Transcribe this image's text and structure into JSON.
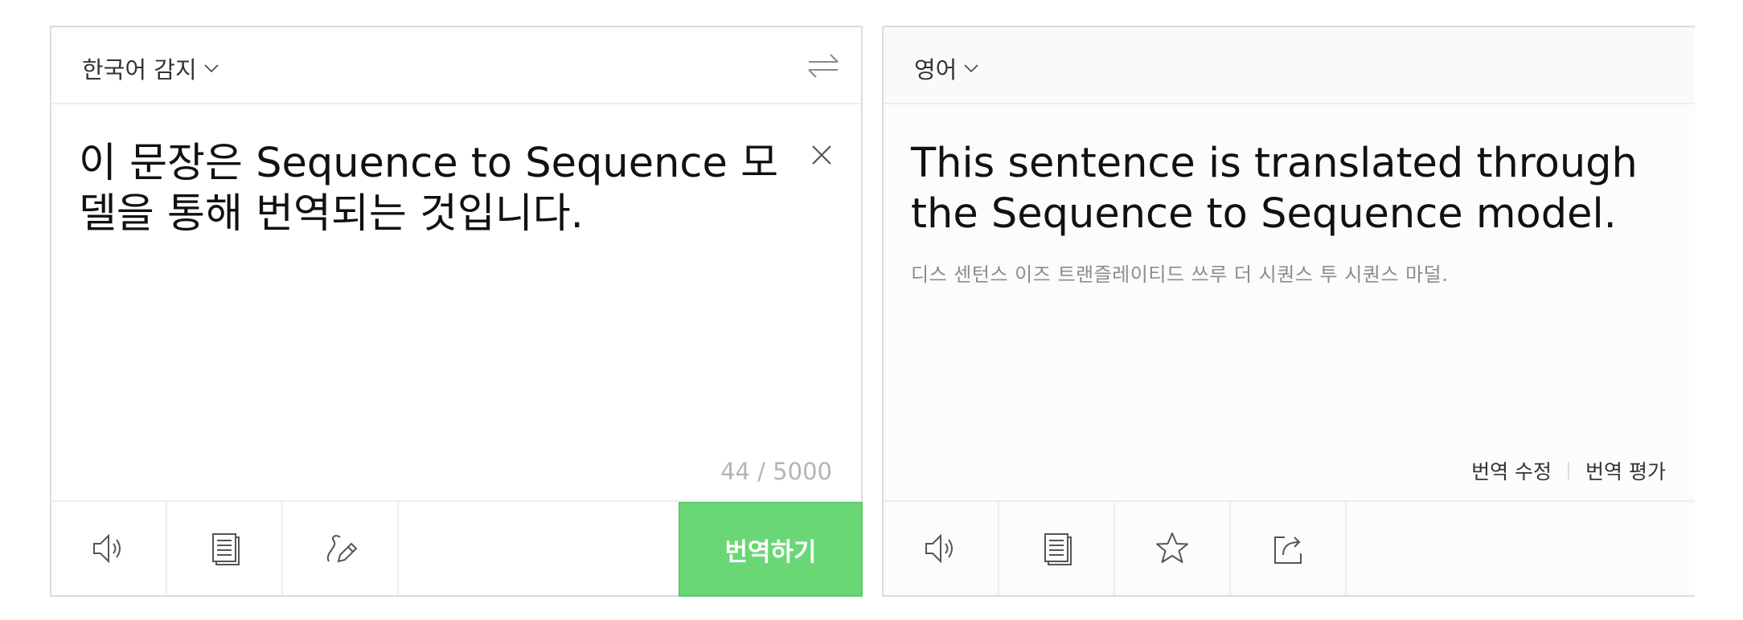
{
  "source": {
    "language_label": "한국어 감지",
    "text": "이 문장은 Sequence to Sequence 모델을 통해 번역되는 것입니다.",
    "char_count": "44 / 5000",
    "translate_button": "번역하기",
    "toolbar_icons": [
      "speaker-icon",
      "copy-icon",
      "handwriting-icon"
    ]
  },
  "target": {
    "language_label": "영어",
    "text": "This sentence is translated through the Sequence to Sequence model.",
    "pronunciation": "디스 센턴스 이즈 트랜즐레이티드 쓰루 더 시퀀스 투 시퀀스 마덜.",
    "edit_link": "번역 수정",
    "rate_link": "번역 평가",
    "toolbar_icons": [
      "speaker-icon",
      "copy-icon",
      "star-icon",
      "share-icon"
    ]
  },
  "colors": {
    "accent_green": "#69d775",
    "border": "#dcdcdc",
    "muted_text": "#8c8c8c"
  }
}
